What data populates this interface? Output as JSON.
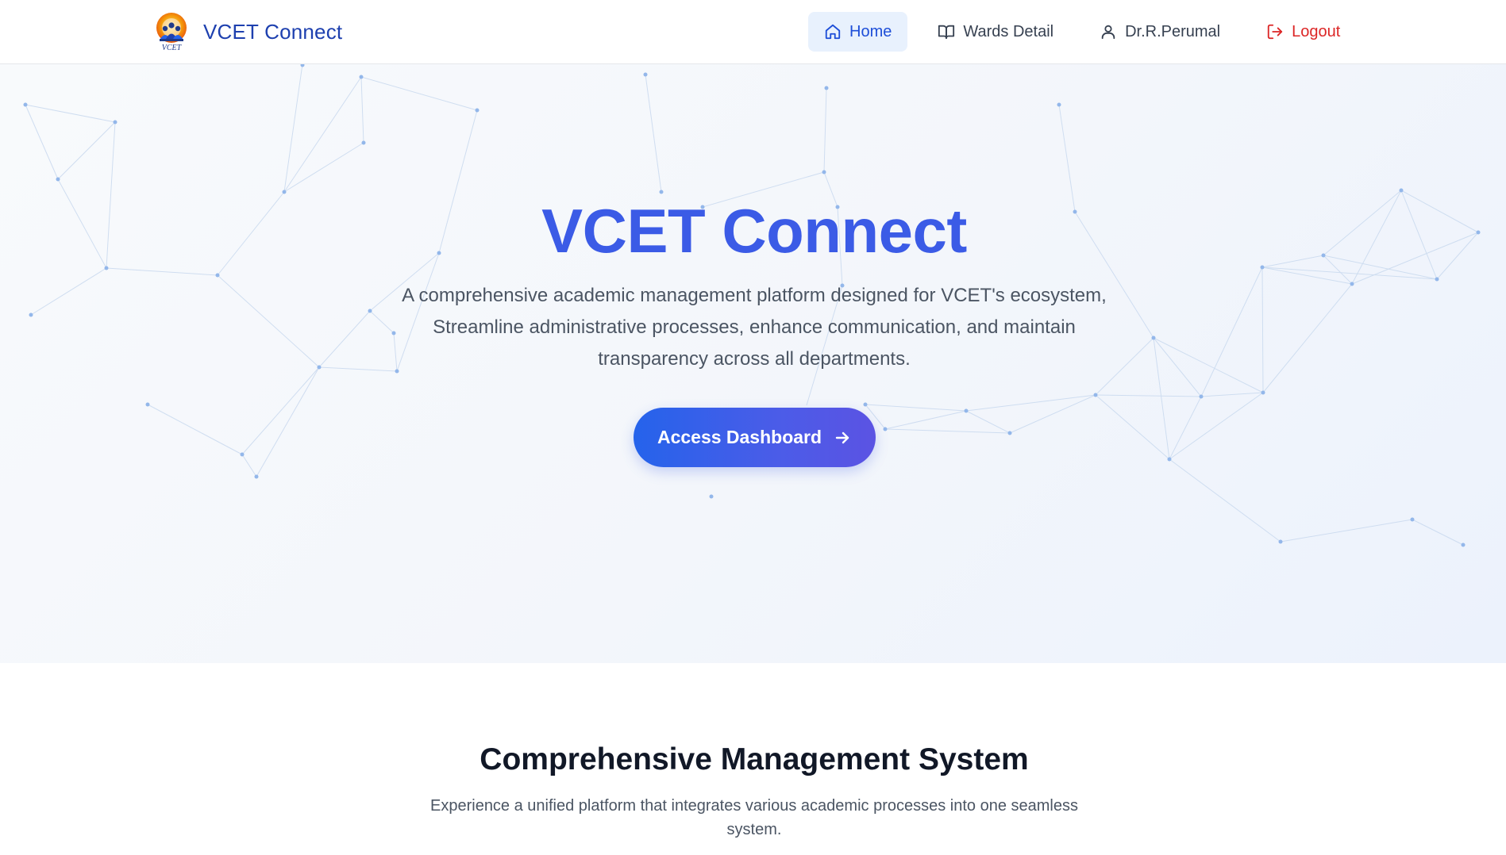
{
  "navbar": {
    "brand_name": "VCET Connect",
    "logo_text": "VCET",
    "items": [
      {
        "label": "Home",
        "icon": "home-icon",
        "active": true
      },
      {
        "label": "Wards Detail",
        "icon": "book-open-icon",
        "active": false
      },
      {
        "label": "Dr.R.Perumal",
        "icon": "user-icon",
        "active": false
      },
      {
        "label": "Logout",
        "icon": "logout-icon",
        "active": false
      }
    ]
  },
  "hero": {
    "title": "VCET Connect",
    "description": "A comprehensive academic management platform designed for VCET's ecosystem, Streamline administrative processes, enhance communication, and maintain transparency across all departments.",
    "cta_label": "Access Dashboard",
    "cta_icon": "arrow-right-icon"
  },
  "features": {
    "title": "Comprehensive Management System",
    "description": "Experience a unified platform that integrates various academic processes into one seamless system."
  },
  "colors": {
    "brand_blue": "#1e40af",
    "hero_title": "#3b5be6",
    "active_bg": "#e8f1fd",
    "active_text": "#1d4ed8",
    "logout_red": "#dc2626",
    "button_gradient_start": "#2563eb",
    "button_gradient_end": "#5b53e3",
    "network_dot": "#93b7ea"
  }
}
